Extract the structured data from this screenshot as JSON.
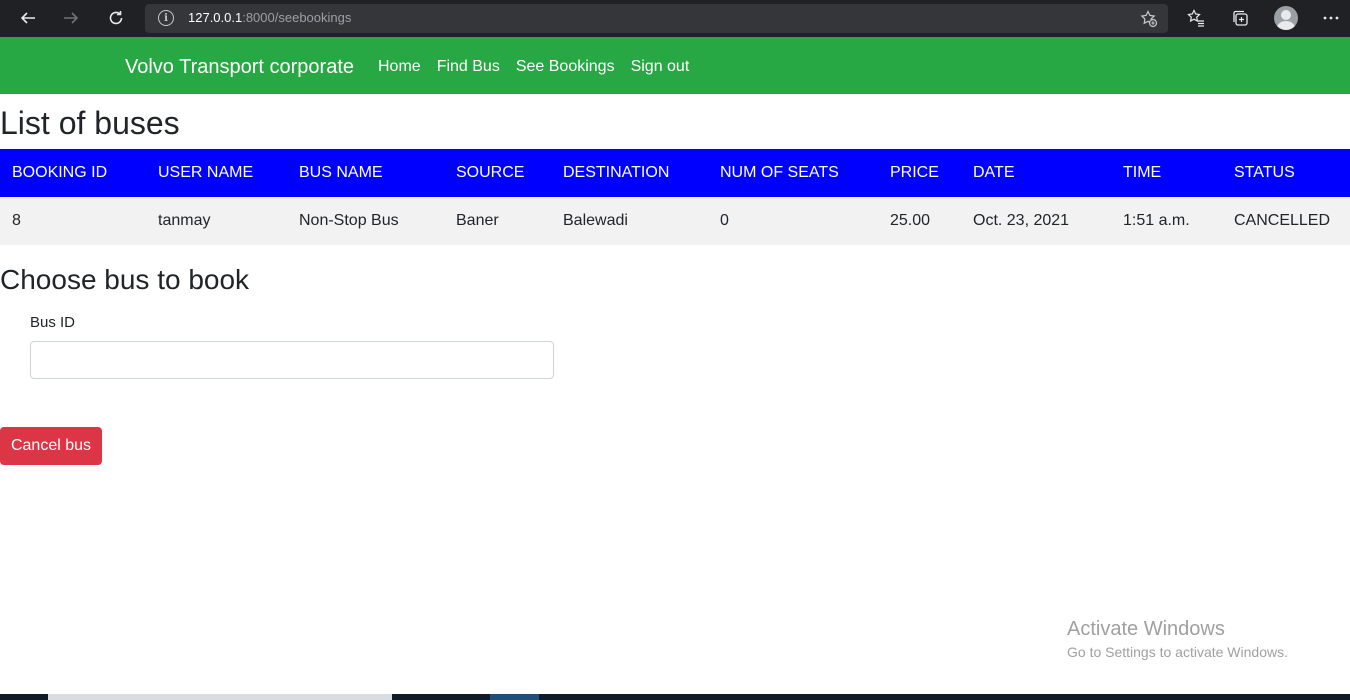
{
  "browser": {
    "url_host": "127.0.0.1",
    "url_rest": ":8000/seebookings"
  },
  "navbar": {
    "brand": "Volvo Transport corporate",
    "links": [
      "Home",
      "Find Bus",
      "See Bookings",
      "Sign out"
    ],
    "bg_color": "#28a745"
  },
  "page_title": "List of buses",
  "table": {
    "header_color": "#0000ff",
    "columns": [
      "BOOKING ID",
      "USER NAME",
      "BUS NAME",
      "SOURCE",
      "DESTINATION",
      "NUM OF SEATS",
      "PRICE",
      "DATE",
      "TIME",
      "STATUS"
    ],
    "rows": [
      [
        "8",
        "tanmay",
        "Non-Stop Bus",
        "Baner",
        "Balewadi",
        "0",
        "25.00",
        "Oct. 23, 2021",
        "1:51 a.m.",
        "CANCELLED"
      ]
    ]
  },
  "form": {
    "title": "Choose bus to book",
    "label": "Bus ID",
    "value": "",
    "button_label": "Cancel bus",
    "button_color": "#dc3545"
  },
  "watermark": {
    "title": "Activate Windows",
    "subtitle": "Go to Settings to activate Windows."
  }
}
